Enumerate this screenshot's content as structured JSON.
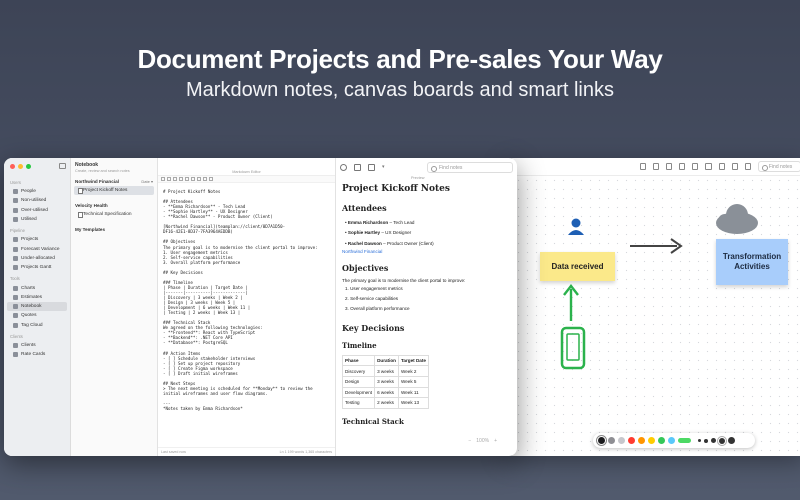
{
  "hero": {
    "title": "Document Projects and Pre-sales Your Way",
    "subtitle": "Markdown notes, canvas boards and smart links"
  },
  "colors": {
    "traffic_red": "#ff5f57",
    "traffic_yellow": "#febc2e",
    "traffic_green": "#28c840",
    "accent_green": "#2bb24c",
    "sticky_yellow": "#fbe98a",
    "sticky_blue": "#a8cdfb"
  },
  "sidebar": {
    "sections": [
      {
        "title": "Users",
        "items": [
          {
            "label": "People",
            "icon": "people-icon"
          },
          {
            "label": "Non-utilised",
            "icon": "user-icon"
          },
          {
            "label": "Over-utilised",
            "icon": "user-icon"
          },
          {
            "label": "Utilised",
            "icon": "user-icon"
          }
        ]
      },
      {
        "title": "Pipeline",
        "items": [
          {
            "label": "Projects",
            "icon": "folder-icon"
          },
          {
            "label": "Forecast Variance",
            "icon": "chart-icon"
          },
          {
            "label": "Under-allocated",
            "icon": "list-icon"
          },
          {
            "label": "Projects Gantt",
            "icon": "gantt-icon"
          }
        ]
      },
      {
        "title": "Tools",
        "items": [
          {
            "label": "Charts",
            "icon": "chart-icon"
          },
          {
            "label": "Estimates",
            "icon": "calculator-icon"
          },
          {
            "label": "Notebook",
            "icon": "notebook-icon"
          },
          {
            "label": "Quotes",
            "icon": "quote-icon"
          },
          {
            "label": "Tag Cloud",
            "icon": "tag-icon"
          }
        ]
      },
      {
        "title": "Clients",
        "items": [
          {
            "label": "Clients",
            "icon": "building-icon"
          },
          {
            "label": "Rate Cards",
            "icon": "card-icon"
          }
        ]
      }
    ],
    "active": "Notebook"
  },
  "notes_list": {
    "title": "Notebook",
    "subtitle": "Create, review and search notes",
    "sort_label": "Date",
    "groups": [
      {
        "name": "Northwind Financial",
        "notes": [
          "Project Kickoff Notes"
        ]
      },
      {
        "name": "Velocity Health",
        "notes": [
          "Technical Specification"
        ]
      },
      {
        "name": "My Templates",
        "notes": []
      }
    ]
  },
  "editor": {
    "label": "Markdown Editor",
    "content": "# Project Kickoff Notes\n\n## Attendees\n- **Emma Richardson** - Tech Lead\n- **Sophie Hartley** - UX Designer\n- **Rachel Dawson** - Product Owner (Client)\n\n[Northwind Financial](teamplan://client/0D7A1D50-\nDF16-42E1-8D37-7FA3964AEDDB)\n\n## Objectives\nThe primary goal is to modernise the client portal to improve:\n1. User engagement metrics\n2. Self-service capabilities\n3. Overall platform performance\n\n## Key Decisions\n\n### Timeline\n| Phase | Duration | Target Date |\n|-------|----------|-------------|\n| Discovery | 3 weeks | Week 2 |\n| Design | 3 weeks | Week 5 |\n| Development | 6 weeks | Week 11 |\n| Testing | 2 weeks | Week 13 |\n\n### Technical Stack\nWe agreed on the following technologies:\n- **Frontend**: React with TypeScript\n- **Backend**: .NET Core API\n- **Database**: PostgreSQL\n\n## Action Items\n- [ ] Schedule stakeholder interviews\n- [ ] Set up project repository\n- [ ] Create Figma workspace\n- [ ] Draft initial wireframes\n\n## Next Steps\n> The next meeting is scheduled for **Monday** to review the\ninitial wireframes and user flow diagrams.\n\n---\n*Notes taken by Emma Richardson*",
    "footer_left": "Last saved now",
    "footer_right": "Ln 1  199 words  1,365 characters"
  },
  "preview": {
    "label": "Preview",
    "find_placeholder": "Find notes",
    "title": "Project Kickoff Notes",
    "attendees_heading": "Attendees",
    "attendees": [
      {
        "name": "Emma Richardson",
        "role": " – Tech Lead"
      },
      {
        "name": "Sophie Hartley",
        "role": " – UX Designer"
      },
      {
        "name": "Rachel Dawson",
        "role": " – Product Owner (Client)"
      }
    ],
    "client_link": "Northwind Financial",
    "objectives_heading": "Objectives",
    "objectives_intro": "The primary goal is to modernise the client portal to improve:",
    "objectives": [
      "User engagement metrics",
      "Self-service capabilities",
      "Overall platform performance"
    ],
    "decisions_heading": "Key Decisions",
    "timeline_heading": "Timeline",
    "table_headers": [
      "Phase",
      "Duration",
      "Target Date"
    ],
    "table_rows": [
      [
        "Discovery",
        "3 weeks",
        "Week 2"
      ],
      [
        "Design",
        "3 weeks",
        "Week 5"
      ],
      [
        "Development",
        "6 weeks",
        "Week 11"
      ],
      [
        "Testing",
        "2 weeks",
        "Week 13"
      ]
    ],
    "stack_heading": "Technical Stack"
  },
  "canvas": {
    "find_placeholder": "Find notes",
    "sticky_yellow": "Data received",
    "sticky_blue": "Transformation Activities",
    "zoom": "100%",
    "palette": [
      "#1c1c1e",
      "#8e8e93",
      "#c7c7cc",
      "#ff3b30",
      "#ff9500",
      "#ffcc00",
      "#34c759",
      "#5ac8fa",
      "#5856d6"
    ]
  }
}
